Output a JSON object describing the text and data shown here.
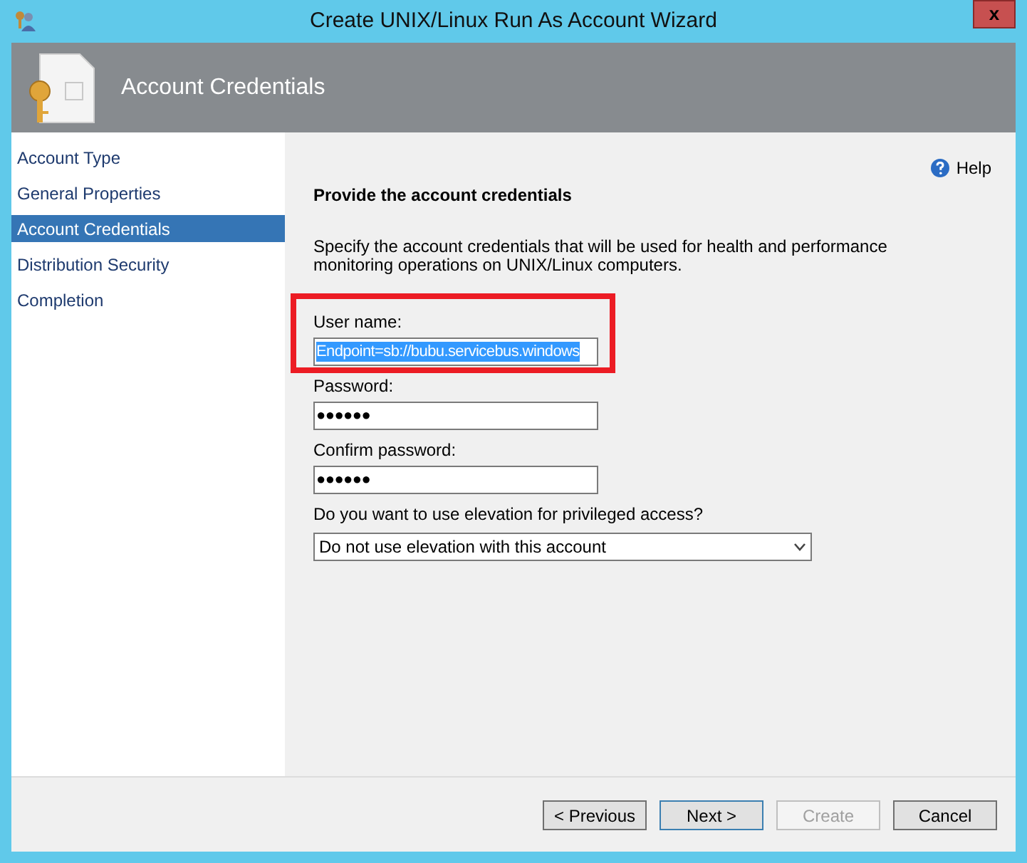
{
  "window": {
    "title": "Create UNIX/Linux Run As Account Wizard",
    "close": "x"
  },
  "header": {
    "title": "Account Credentials"
  },
  "sidebar": {
    "items": [
      {
        "label": "Account Type",
        "selected": false
      },
      {
        "label": "General Properties",
        "selected": false
      },
      {
        "label": "Account Credentials",
        "selected": true
      },
      {
        "label": "Distribution Security",
        "selected": false
      },
      {
        "label": "Completion",
        "selected": false
      }
    ]
  },
  "content": {
    "help": "Help",
    "heading": "Provide the account credentials",
    "description": "Specify the account credentials that will be used for health and performance monitoring operations on UNIX/Linux computers.",
    "fields": [
      {
        "label": "User name:",
        "value": "Endpoint=sb://bubu.servicebus.windows",
        "highlighted": true
      },
      {
        "label": "Password:",
        "value": "●●●●●●",
        "highlighted": false
      },
      {
        "label": "Confirm password:",
        "value": "●●●●●●",
        "highlighted": false
      }
    ],
    "elevation": {
      "label": "Do you want to use elevation for privileged access?",
      "value": "Do not use elevation with this account"
    }
  },
  "buttons": [
    {
      "label": "< Previous",
      "disabled": false,
      "focused": false
    },
    {
      "label": "Next >",
      "disabled": false,
      "focused": true
    },
    {
      "label": "Create",
      "disabled": true,
      "focused": false
    },
    {
      "label": "Cancel",
      "disabled": false,
      "focused": false
    }
  ]
}
